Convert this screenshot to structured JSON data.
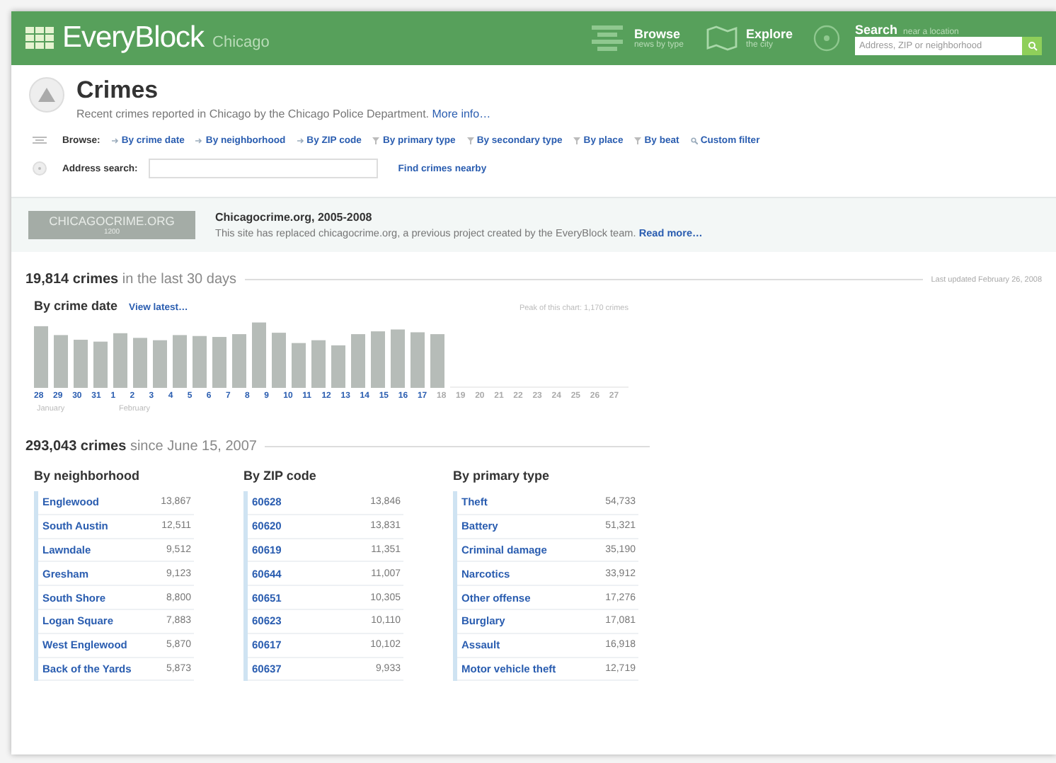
{
  "header": {
    "logo": "EveryBlock",
    "city": "Chicago",
    "nav": [
      {
        "kind": "browse",
        "label": "Browse",
        "sub": "news by type"
      },
      {
        "kind": "explore",
        "label": "Explore",
        "sub": "the city"
      }
    ],
    "search": {
      "label": "Search",
      "sub": "near a location",
      "placeholder": "Address, ZIP or neighborhood"
    }
  },
  "section": {
    "title": "Crimes",
    "description": "Recent crimes reported in Chicago by the Chicago Police Department.",
    "more_link": "More info…",
    "browse_label": "Browse:",
    "browse_links": [
      {
        "kind": "arrow",
        "label": "By crime date"
      },
      {
        "kind": "arrow",
        "label": "By neighborhood"
      },
      {
        "kind": "arrow",
        "label": "By ZIP code"
      },
      {
        "kind": "filter",
        "label": "By primary type"
      },
      {
        "kind": "filter",
        "label": "By secondary type"
      },
      {
        "kind": "filter",
        "label": "By place"
      },
      {
        "kind": "filter",
        "label": "By beat"
      },
      {
        "kind": "search",
        "label": "Custom filter"
      }
    ],
    "address_label": "Address search:",
    "address_link": "Find crimes nearby"
  },
  "banner": {
    "badge": "CHICAGOCRIME.ORG",
    "badge_sub": "1200",
    "title": "Chicagocrime.org, 2005-2008",
    "text": "This site has replaced chicagocrime.org, a previous project created by the EveryBlock team.",
    "link": "Read more…"
  },
  "recent": {
    "count": "19,814 crimes",
    "period": "in the last 30 days",
    "updated": "Last updated February 26, 2008",
    "chart_title": "By crime date",
    "chart_link": "View latest…",
    "peak": "Peak of this chart: 1,170 crimes",
    "days": [
      {
        "label": "28",
        "has_data": true
      },
      {
        "label": "29",
        "has_data": true
      },
      {
        "label": "30",
        "has_data": true
      },
      {
        "label": "31",
        "has_data": true
      },
      {
        "label": "1",
        "has_data": true
      },
      {
        "label": "2",
        "has_data": true
      },
      {
        "label": "3",
        "has_data": true
      },
      {
        "label": "4",
        "has_data": true
      },
      {
        "label": "5",
        "has_data": true
      },
      {
        "label": "6",
        "has_data": true
      },
      {
        "label": "7",
        "has_data": true
      },
      {
        "label": "8",
        "has_data": true
      },
      {
        "label": "9",
        "has_data": true
      },
      {
        "label": "10",
        "has_data": true
      },
      {
        "label": "11",
        "has_data": true
      },
      {
        "label": "12",
        "has_data": true
      },
      {
        "label": "13",
        "has_data": true
      },
      {
        "label": "14",
        "has_data": true
      },
      {
        "label": "15",
        "has_data": true
      },
      {
        "label": "16",
        "has_data": true
      },
      {
        "label": "17",
        "has_data": true
      },
      {
        "label": "18",
        "has_data": false
      },
      {
        "label": "19",
        "has_data": false
      },
      {
        "label": "20",
        "has_data": false
      },
      {
        "label": "21",
        "has_data": false
      },
      {
        "label": "22",
        "has_data": false
      },
      {
        "label": "23",
        "has_data": false
      },
      {
        "label": "24",
        "has_data": false
      },
      {
        "label": "25",
        "has_data": false
      },
      {
        "label": "26",
        "has_data": false
      },
      {
        "label": "27",
        "has_data": false
      }
    ],
    "months": [
      "January",
      "February"
    ]
  },
  "totals": {
    "count": "293,043 crimes",
    "period": "since June 15, 2007",
    "lists": [
      {
        "title": "By neighborhood",
        "rows": [
          {
            "name": "Englewood",
            "count": "13,867"
          },
          {
            "name": "South Austin",
            "count": "12,511"
          },
          {
            "name": "Lawndale",
            "count": "9,512"
          },
          {
            "name": "Gresham",
            "count": "9,123"
          },
          {
            "name": "South Shore",
            "count": "8,800"
          },
          {
            "name": "Logan Square",
            "count": "7,883"
          },
          {
            "name": "West Englewood",
            "count": "5,870"
          },
          {
            "name": "Back of the Yards",
            "count": "5,873"
          }
        ]
      },
      {
        "title": "By ZIP code",
        "rows": [
          {
            "name": "60628",
            "count": "13,846"
          },
          {
            "name": "60620",
            "count": "13,831"
          },
          {
            "name": "60619",
            "count": "11,351"
          },
          {
            "name": "60644",
            "count": "11,007"
          },
          {
            "name": "60651",
            "count": "10,305"
          },
          {
            "name": "60623",
            "count": "10,110"
          },
          {
            "name": "60617",
            "count": "10,102"
          },
          {
            "name": "60637",
            "count": "9,933"
          }
        ]
      },
      {
        "title": "By primary type",
        "rows": [
          {
            "name": "Theft",
            "count": "54,733"
          },
          {
            "name": "Battery",
            "count": "51,321"
          },
          {
            "name": "Criminal damage",
            "count": "35,190"
          },
          {
            "name": "Narcotics",
            "count": "33,912"
          },
          {
            "name": "Other offense",
            "count": "17,276"
          },
          {
            "name": "Burglary",
            "count": "17,081"
          },
          {
            "name": "Assault",
            "count": "16,918"
          },
          {
            "name": "Motor vehicle theft",
            "count": "12,719"
          }
        ]
      }
    ]
  }
}
